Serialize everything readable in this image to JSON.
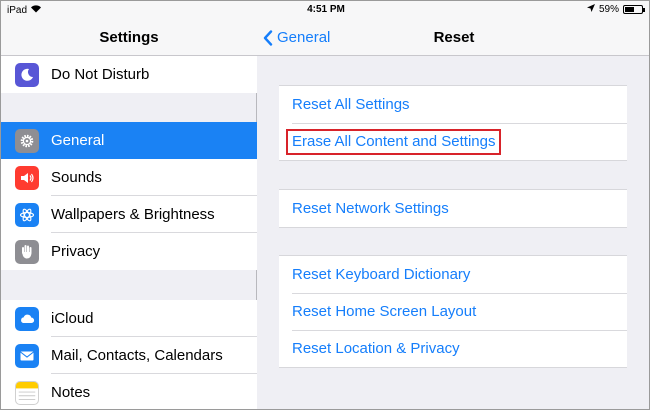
{
  "status_bar": {
    "device": "iPad",
    "time": "4:51 PM",
    "battery_percent": "59%",
    "battery_level": 0.59
  },
  "left_pane": {
    "title": "Settings",
    "items": [
      {
        "label": "Do Not Disturb",
        "icon": "moon-icon",
        "color": "#5856d6"
      },
      {
        "label": "General",
        "icon": "gear-icon",
        "color": "#8e8e93",
        "selected": true
      },
      {
        "label": "Sounds",
        "icon": "speaker-icon",
        "color": "#ff3b30"
      },
      {
        "label": "Wallpapers & Brightness",
        "icon": "flower-icon",
        "color": "#1a82f4"
      },
      {
        "label": "Privacy",
        "icon": "hand-icon",
        "color": "#8e8e93"
      },
      {
        "label": "iCloud",
        "icon": "cloud-icon",
        "color": "#1a82f4"
      },
      {
        "label": "Mail, Contacts, Calendars",
        "icon": "mail-icon",
        "color": "#1a82f4"
      },
      {
        "label": "Notes",
        "icon": "notes-icon",
        "color": "#ffcc00"
      }
    ]
  },
  "right_pane": {
    "back_label": "General",
    "title": "Reset",
    "groups": [
      [
        "Reset All Settings",
        "Erase All Content and Settings"
      ],
      [
        "Reset Network Settings"
      ],
      [
        "Reset Keyboard Dictionary",
        "Reset Home Screen Layout",
        "Reset Location & Privacy"
      ]
    ],
    "highlighted_item": "Erase All Content and Settings",
    "highlight_color": "#d8232a"
  },
  "colors": {
    "accent": "#157efb",
    "selection": "#1a82f4",
    "background": "#efeff4"
  }
}
